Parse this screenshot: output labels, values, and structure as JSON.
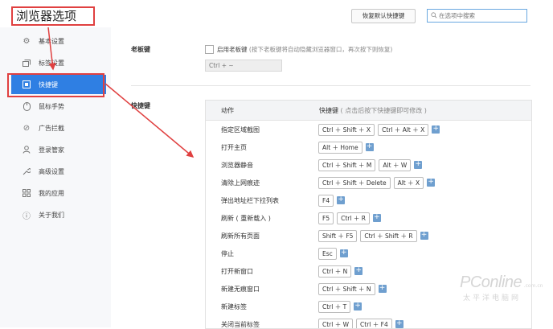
{
  "header": {
    "title": "浏览器选项",
    "restore_button": "恢复默认快捷键",
    "search_placeholder": "在选项中搜索"
  },
  "sidebar": {
    "items": [
      {
        "label": "基本设置",
        "icon": "gear-icon"
      },
      {
        "label": "标签设置",
        "icon": "tabs-icon"
      },
      {
        "label": "快捷键",
        "icon": "keyboard-icon"
      },
      {
        "label": "鼠标手势",
        "icon": "mouse-icon"
      },
      {
        "label": "广告拦截",
        "icon": "block-icon"
      },
      {
        "label": "登录管家",
        "icon": "user-icon"
      },
      {
        "label": "高级设置",
        "icon": "wrench-icon"
      },
      {
        "label": "我的应用",
        "icon": "apps-icon"
      },
      {
        "label": "关于我们",
        "icon": "info-icon"
      }
    ],
    "active_index": 2
  },
  "boss_key": {
    "section": "老板键",
    "checkbox_label": "启用老板键",
    "hint": "(按下老板键将自动隐藏浏览器窗口，再次按下则恢复)",
    "value": "Ctrl + ~"
  },
  "shortcuts": {
    "section": "快捷键",
    "col_action": "动作",
    "col_keys": "快捷键",
    "col_keys_hint": "( 点击后按下快捷键即可修改 )",
    "rows": [
      {
        "action": "指定区域截图",
        "keys": [
          "Ctrl ＋ Shift ＋ X",
          "Ctrl ＋ Alt ＋ X"
        ]
      },
      {
        "action": "打开主页",
        "keys": [
          "Alt ＋ Home"
        ]
      },
      {
        "action": "浏览器静音",
        "keys": [
          "Ctrl ＋ Shift ＋ M",
          "Alt ＋ W"
        ]
      },
      {
        "action": "清除上网痕迹",
        "keys": [
          "Ctrl ＋ Shift ＋ Delete",
          "Alt ＋ X"
        ]
      },
      {
        "action": "弹出地址栏下拉列表",
        "keys": [
          "F4"
        ]
      },
      {
        "action": "刷新 ( 重新载入 )",
        "keys": [
          "F5",
          "Ctrl ＋ R"
        ]
      },
      {
        "action": "刷新所有页面",
        "keys": [
          "Shift ＋ F5",
          "Ctrl ＋ Shift ＋ R"
        ]
      },
      {
        "action": "停止",
        "keys": [
          "Esc"
        ]
      },
      {
        "action": "打开新窗口",
        "keys": [
          "Ctrl ＋ N"
        ]
      },
      {
        "action": "新建无痕窗口",
        "keys": [
          "Ctrl ＋ Shift ＋ N"
        ]
      },
      {
        "action": "新建标签",
        "keys": [
          "Ctrl ＋ T"
        ]
      },
      {
        "action": "关闭当前标签",
        "keys": [
          "Ctrl ＋ W",
          "Ctrl ＋ F4"
        ]
      }
    ],
    "add_symbol": "+"
  },
  "watermark": {
    "brand": "PConline",
    "domain": ".com.cn",
    "slogan": "太平洋电脑网"
  },
  "colors": {
    "accent": "#2f7fe3",
    "annotation": "#e04040",
    "add_button": "#6f9fcf"
  }
}
